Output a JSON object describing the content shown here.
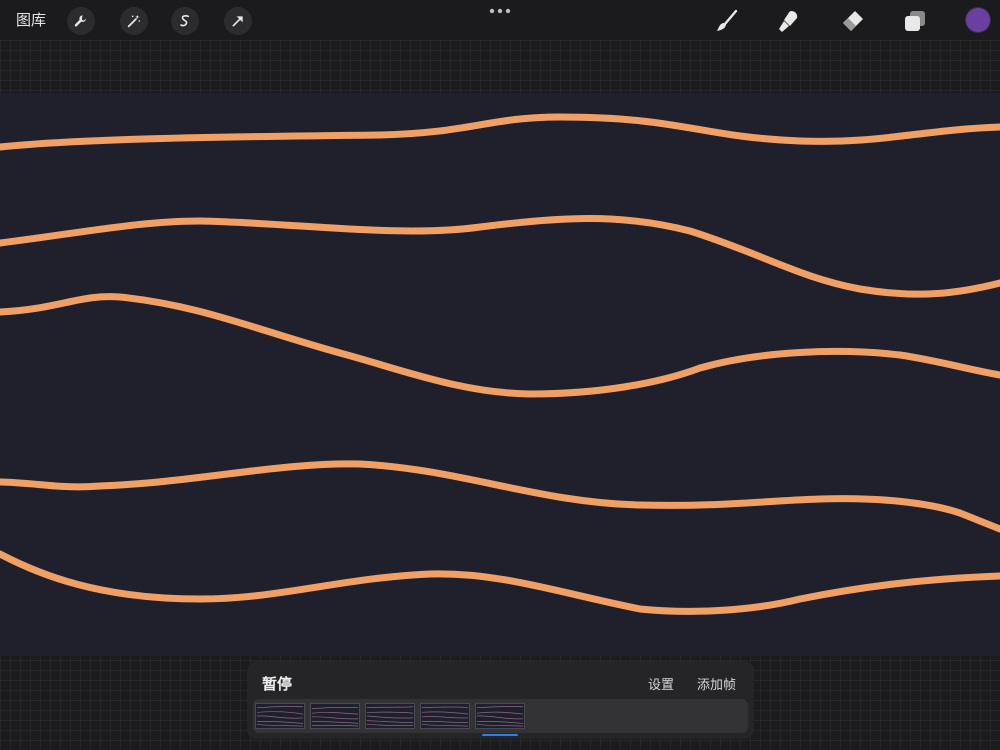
{
  "topbar": {
    "gallery_label": "图库",
    "left_tools": [
      {
        "name": "wrench-icon"
      },
      {
        "name": "magic-wand-icon"
      },
      {
        "name": "selection-s-icon"
      },
      {
        "name": "transform-arrow-icon"
      }
    ],
    "more_icon": "ellipsis-icon",
    "right_tools": [
      {
        "name": "brush-icon"
      },
      {
        "name": "smudge-icon"
      },
      {
        "name": "eraser-icon"
      },
      {
        "name": "layers-icon"
      }
    ],
    "current_color": "#6b3fa0"
  },
  "canvas": {
    "background": "#20202c",
    "stroke_color": "#f0a064"
  },
  "animation_panel": {
    "play_label": "暂停",
    "settings_label": "设置",
    "add_frame_label": "添加帧",
    "frame_count": 5
  },
  "colors": {
    "accent_blue": "#2e7cf6",
    "ui_dark": "#1c1c1e"
  }
}
